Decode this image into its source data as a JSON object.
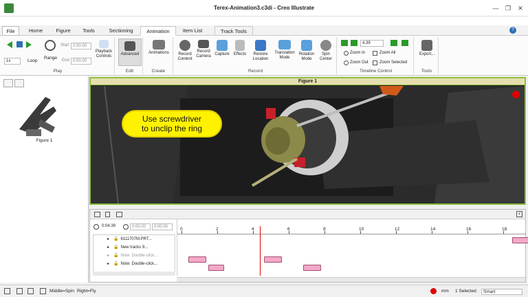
{
  "window": {
    "title": "Terex-Animation3.c3di - Creo Illustrate"
  },
  "tabs": [
    {
      "label": "File"
    },
    {
      "label": "Home"
    },
    {
      "label": "Figure"
    },
    {
      "label": "Tools"
    },
    {
      "label": "Sectioning"
    },
    {
      "label": "Animation"
    },
    {
      "label": "Item List"
    },
    {
      "label": "Track Tools"
    }
  ],
  "ribbon": {
    "play": {
      "speed": "1x",
      "loop": "Loop",
      "range": "Range",
      "start_label": "Start",
      "start_value": "0:00.00",
      "end_label": "End",
      "end_value": "0:00.00",
      "playback": "Playback\nControls",
      "group": "Play"
    },
    "edit": {
      "advanced": "Advanced",
      "group": "Edit"
    },
    "create": {
      "animations": "Animations",
      "group": "Create"
    },
    "record": {
      "record_content": "Record\nContent",
      "record_camera": "Record\nCamera",
      "capture": "Capture",
      "effects": "Effects",
      "restore_location": "Restore\nLocation",
      "translation_mode": "Translation\nMode",
      "rotation_mode": "Rotation\nMode",
      "spin_center": "Spin\nCenter",
      "group": "Record"
    },
    "timeline_control": {
      "time_value": "4.39",
      "zoom_in": "Zoom In",
      "zoom_all": "Zoom All",
      "zoom_out": "Zoom Out",
      "zoom_selected": "Zoom Selected",
      "group": "Timeline Control"
    },
    "tools": {
      "export": "Export...",
      "group": "Tools"
    }
  },
  "leftpane": {
    "thumbnail_label": "Figure 1"
  },
  "viewer": {
    "title": "Figure 1",
    "callout": "Use screwdriver\nto unclip the ring"
  },
  "timeline": {
    "current_time": "0:04.39",
    "start_time": "0:00.00",
    "end_time": "0:00.00",
    "tracks": [
      "6111707M.PRT...",
      "New tracks 9...",
      "Note: Double-click...",
      "Note: Double-click..."
    ],
    "ticks": [
      "0",
      "2",
      "4",
      "6",
      "8",
      "10",
      "12",
      "14",
      "16",
      "18"
    ],
    "playhead_time": 4.39,
    "bars": [
      {
        "track": 2,
        "start": 0.4,
        "end": 1.4
      },
      {
        "track": 3,
        "start": 1.5,
        "end": 2.4
      },
      {
        "track": 2,
        "start": 4.6,
        "end": 5.6
      },
      {
        "track": 3,
        "start": 6.8,
        "end": 7.8
      },
      {
        "track": 0,
        "start": 18.5,
        "end": 19.5
      }
    ]
  },
  "status": {
    "mouse_hint_1": "Middle=Spin",
    "mouse_hint_2": "Right=Fly",
    "units": "mm",
    "selected": "1 Selected",
    "mode": "Smart"
  }
}
